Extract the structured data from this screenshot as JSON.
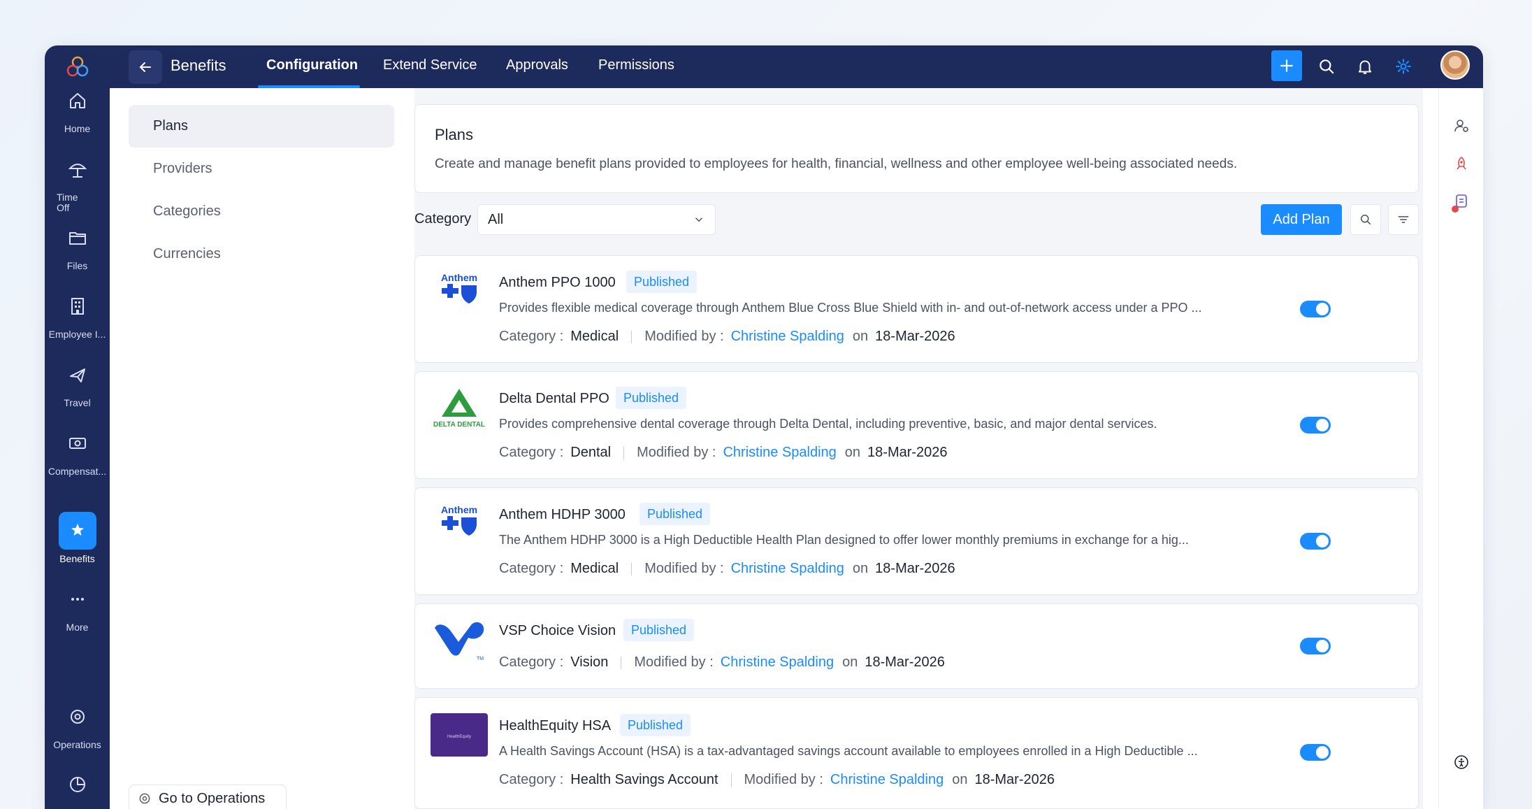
{
  "rail": {
    "items": [
      {
        "label": "Home",
        "icon": "home-icon"
      },
      {
        "label": "Time Off",
        "icon": "beach-umbrella-icon"
      },
      {
        "label": "Files",
        "icon": "folder-icon"
      },
      {
        "label": "Employee I...",
        "icon": "building-icon"
      },
      {
        "label": "Travel",
        "icon": "airplane-icon"
      },
      {
        "label": "Compensat...",
        "icon": "compensation-icon"
      },
      {
        "label": "Benefits",
        "icon": "benefits-icon"
      },
      {
        "label": "More",
        "icon": "more-icon"
      },
      {
        "label": "Operations",
        "icon": "operations-icon"
      }
    ]
  },
  "topbar": {
    "app_title": "Benefits",
    "tabs": [
      "Configuration",
      "Extend Service",
      "Approvals",
      "Permissions"
    ]
  },
  "subnav": {
    "items": [
      "Plans",
      "Providers",
      "Categories",
      "Currencies"
    ],
    "go_ops": "Go to Operations"
  },
  "header": {
    "title": "Plans",
    "description": "Create and manage benefit plans provided to employees for health, financial, wellness and other employee well-being associated needs."
  },
  "filters": {
    "category_label": "Category",
    "category_value": "All",
    "add_plan": "Add Plan"
  },
  "labels": {
    "category": "Category :",
    "modified_by": "Modified by :",
    "on": "on"
  },
  "plans": [
    {
      "name": "Anthem PPO 1000",
      "status": "Published",
      "description": "Provides flexible medical coverage through Anthem Blue Cross Blue Shield with in- and out-of-network access under a PPO ...",
      "category": "Medical",
      "modified_by": "Christine Spalding",
      "date": "18-Mar-2026",
      "logo_text": "Anthem"
    },
    {
      "name": "Delta Dental PPO",
      "status": "Published",
      "description": "Provides comprehensive dental coverage through Delta Dental, including preventive, basic, and major dental services.",
      "category": "Dental",
      "modified_by": "Christine Spalding",
      "date": "18-Mar-2026",
      "logo_text": "DELTA DENTAL"
    },
    {
      "name": "Anthem HDHP 3000",
      "status": "Published",
      "description": "The Anthem HDHP 3000 is a High Deductible Health Plan designed to offer lower monthly premiums in exchange for a hig...",
      "category": "Medical",
      "modified_by": "Christine Spalding",
      "date": "18-Mar-2026",
      "logo_text": "Anthem"
    },
    {
      "name": "VSP Choice Vision",
      "status": "Published",
      "description": "",
      "category": "Vision",
      "modified_by": "Christine Spalding",
      "date": "18-Mar-2026",
      "logo_text": "TM"
    },
    {
      "name": "HealthEquity HSA",
      "status": "Published",
      "description": "A Health Savings Account (HSA) is a tax-advantaged savings account available to employees enrolled in a High Deductible ...",
      "category": "Health Savings Account",
      "modified_by": "Christine Spalding",
      "date": "18-Mar-2026",
      "logo_text": "HealthEquity"
    }
  ],
  "colors": {
    "primary": "#1a8cff",
    "nav_bg": "#1d2a5c",
    "delta_green": "#2e9b3f",
    "anthem_blue": "#1a4fd6",
    "vsp_blue": "#1a5bdc",
    "healthequity_purple": "#4a2a88"
  }
}
